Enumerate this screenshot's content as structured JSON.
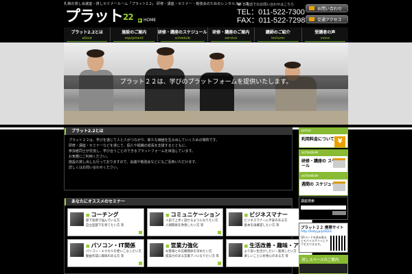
{
  "header": {
    "tagline": "札幌の貸し会議室・貸しセミナールーム「プラット2.2」 研修・講座・セミナー・勉強会のためのレンタルスペース",
    "logo": "プラット",
    "logo_num": "22",
    "home": "HOME",
    "contact_note": "お電話でのお問い合わせはこちら",
    "tel": "TEL：011-522-7300",
    "fax": "FAX：011-522-7298",
    "btn_inquiry": "お問い合わせ",
    "btn_access": "交通アクセス"
  },
  "nav": [
    {
      "jp": "プラット2.2とは",
      "en": "about"
    },
    {
      "jp": "施設のご案内",
      "en": "equipment"
    },
    {
      "jp": "研修・講座のスケジュール",
      "en": "schedule"
    },
    {
      "jp": "研修・講座のご案内",
      "en": "service"
    },
    {
      "jp": "講師のご紹介",
      "en": "lecturer"
    },
    {
      "jp": "受講者の声",
      "en": "voice"
    }
  ],
  "hero": {
    "caption": "プラット２２は、学びのプラットフォームを提供いたします。"
  },
  "about": {
    "title": "プラット2.2とは",
    "lines": [
      "プラット２２は、学びを通じて人と人がつながり、新たな価値を生み出していくための場所です。",
      "研修・講座・セミナーなどを通じて、個人や組織の成長を支援するとともに、",
      "参加者同士が交流し、学び合うことのできるプラットフォームを目指しています。",
      "お気軽にご利用ください。",
      "施設の貸し出しも行っておりますので、会議や勉強会などにもご活用いただけます。",
      "詳しくはお問い合わせください。"
    ]
  },
  "seminars": {
    "title": "あなたにオススメのセミナー",
    "cards": [
      {
        "title": "コーチング",
        "d1": "部下指導で悩んでいる方",
        "d2": "自立型部下を育てたい方 等"
      },
      {
        "title": "コミュニケーション",
        "d1": "人前で上手く話せるようになりたい方",
        "d2": "人間関係を改善したい方 等"
      },
      {
        "title": "ビジネスマナー",
        "d1": "ビジネスマナーに不安のある方",
        "d2": "基本を再確認したい方 等"
      },
      {
        "title": "パソコン・IT関係",
        "d1": "パソコン・エクセルを使いこなしたい方",
        "d2": "動画作成に興味のある方 等"
      },
      {
        "title": "営業力強化",
        "d1": "お客様との信頼関係を深めたい方",
        "d2": "提案力のある営業マンになりたい方 等"
      },
      {
        "title": "生活改善・趣味・アート",
        "d1": "より良い生活がしたい・発達したい方",
        "d2": "楽しいことに好奇心のある方 等"
      }
    ]
  },
  "sidebar": {
    "price_head": "price",
    "price_label": "利用料金について",
    "schedule_head": "schedule",
    "schedule_label": "研修・講座の スケジュール",
    "weekly_head": "schedule",
    "weekly_label": "週間の スケジュール",
    "search_title": "講座検索",
    "mobile_title": "プラット２２ 携帯サイト",
    "mobile_url": "http://katy.jp/plat22/",
    "mobile_desc": "QRコードを読み取るとモバイルサイトにアクセスできます。",
    "rental_title": "貸しスペースのご案内"
  },
  "colors": {
    "accent": "#99cc33",
    "nav_bg": "#111111",
    "orange": "#e8a000"
  }
}
